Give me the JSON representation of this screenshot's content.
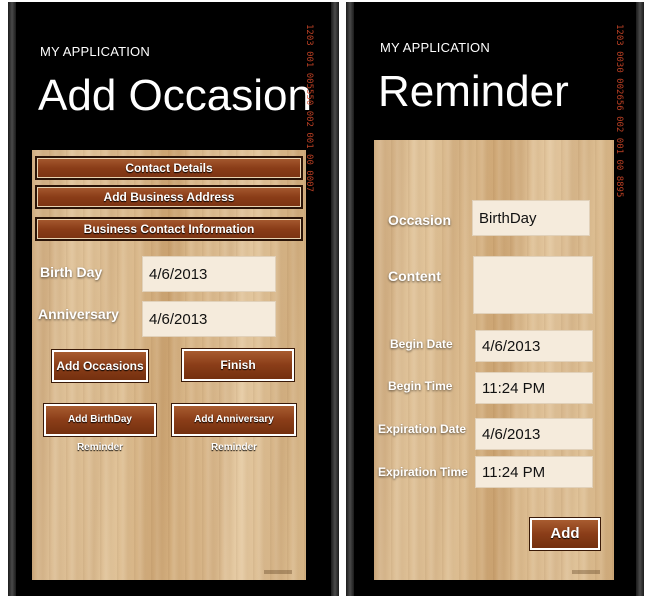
{
  "left_screen": {
    "app_title": "MY APPLICATION",
    "page_title": "Add Occasion",
    "status_strip": "1203 001 005550 002 001 00 0007",
    "menu_buttons": [
      {
        "label": "Contact Details"
      },
      {
        "label": "Add Business Address"
      },
      {
        "label": "Business Contact Information"
      }
    ],
    "fields": [
      {
        "label": "Birth Day",
        "value": "4/6/2013"
      },
      {
        "label": "Anniversary",
        "value": "4/6/2013"
      }
    ],
    "buttons": {
      "add_occasions": "Add Occasions",
      "finish": "Finish",
      "add_birthday_reminder": "Add BirthDay Reminder",
      "add_anniversary_reminder": "Add Anniversary Reminder"
    }
  },
  "right_screen": {
    "app_title": "MY APPLICATION",
    "page_title": "Reminder",
    "status_strip": "1203 0030 002656 002 001 00 8895",
    "fields": [
      {
        "label": "Occasion",
        "value": "BirthDay"
      },
      {
        "label": "Content",
        "value": ""
      },
      {
        "label": "Begin Date",
        "value": "4/6/2013"
      },
      {
        "label": "Begin Time",
        "value": "11:24 PM"
      },
      {
        "label": "Expiration Date",
        "value": "4/6/2013"
      },
      {
        "label": "Expiration Time",
        "value": "11:24 PM"
      }
    ],
    "add_button": "Add"
  },
  "colors": {
    "background": "#000000",
    "wood": "#d9b98c",
    "button_brown": "#8a3d18",
    "field_bg": "#f5ebdc",
    "status_red": "#d94a2a"
  }
}
